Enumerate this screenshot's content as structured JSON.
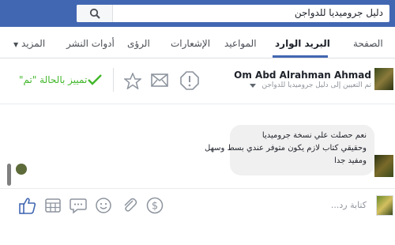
{
  "search": {
    "value": "دليل جروميديا للدواجن"
  },
  "tabs": [
    {
      "label": "الصفحة",
      "active": false
    },
    {
      "label": "البريد الوارد",
      "active": true
    },
    {
      "label": "المواعيد",
      "active": false
    },
    {
      "label": "الإشعارات",
      "active": false
    },
    {
      "label": "الرؤى",
      "active": false
    },
    {
      "label": "أدوات النشر",
      "active": false
    },
    {
      "label": "المزيد",
      "active": false
    }
  ],
  "conversation": {
    "name": "Om Abd Alrahman Ahmad",
    "assigned": "تم التعيين إلى دليل جروميديا للدواجن",
    "mark_done": "تمييز بالحالة \"تم\""
  },
  "message": {
    "lines": [
      "نعم حصلت علي نسخة جروميديا",
      "وحقيقي كتاب لازم يكون متوفر عندي بسط وسهل",
      "ومفيد جدا"
    ]
  },
  "composer": {
    "placeholder": "كتابة رد..."
  },
  "colors": {
    "topbar": "#4267b2",
    "accent": "#4267b2",
    "done_green": "#42b72a"
  }
}
